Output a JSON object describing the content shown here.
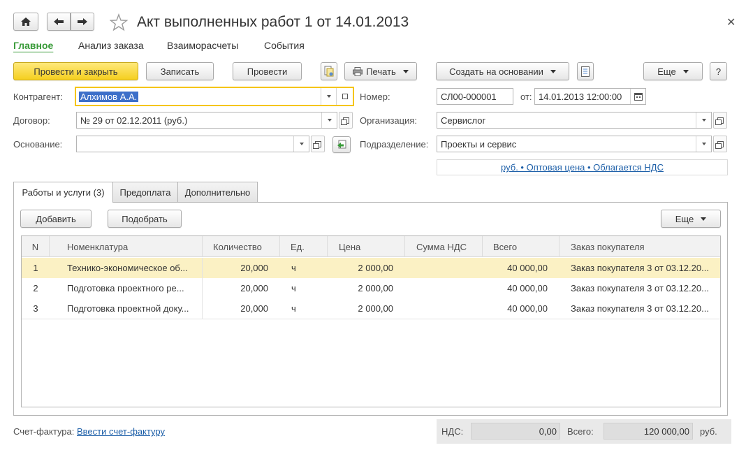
{
  "window": {
    "title": "Акт выполненных работ 1 от 14.01.2013"
  },
  "nav_tabs": [
    {
      "label": "Главное"
    },
    {
      "label": "Анализ заказа"
    },
    {
      "label": "Взаиморасчеты"
    },
    {
      "label": "События"
    }
  ],
  "toolbar": {
    "post_close": "Провести и закрыть",
    "save": "Записать",
    "post": "Провести",
    "print": "Печать",
    "create_based": "Создать на основании",
    "more": "Еще",
    "help": "?"
  },
  "form": {
    "counterparty_label": "Контрагент:",
    "counterparty_value": "Алхимов А.А.",
    "contract_label": "Договор:",
    "contract_value": "№ 29 от 02.12.2011 (руб.)",
    "basis_label": "Основание:",
    "basis_value": "",
    "number_label": "Номер:",
    "number_value": "СЛ00-000001",
    "date_label": "от:",
    "date_value": "14.01.2013 12:00:00",
    "org_label": "Организация:",
    "org_value": "Сервислог",
    "division_label": "Подразделение:",
    "division_value": "Проекты и сервис",
    "price_info": "руб. • Оптовая цена • Облагается НДС"
  },
  "section_tabs": [
    {
      "label": "Работы и услуги (3)"
    },
    {
      "label": "Предоплата"
    },
    {
      "label": "Дополнительно"
    }
  ],
  "table_toolbar": {
    "add": "Добавить",
    "pick": "Подобрать",
    "more": "Еще"
  },
  "table": {
    "columns": [
      "N",
      "Номенклатура",
      "Количество",
      "Ед.",
      "Цена",
      "Сумма НДС",
      "Всего",
      "Заказ покупателя"
    ],
    "rows": [
      {
        "n": "1",
        "item": "Технико-экономическое об...",
        "qty": "20,000",
        "unit": "ч",
        "price": "2 000,00",
        "vat": "",
        "total": "40 000,00",
        "order": "Заказ покупателя 3 от 03.12.20..."
      },
      {
        "n": "2",
        "item": "Подготовка проектного ре...",
        "qty": "20,000",
        "unit": "ч",
        "price": "2 000,00",
        "vat": "",
        "total": "40 000,00",
        "order": "Заказ покупателя 3 от 03.12.20..."
      },
      {
        "n": "3",
        "item": "Подготовка проектной доку...",
        "qty": "20,000",
        "unit": "ч",
        "price": "2 000,00",
        "vat": "",
        "total": "40 000,00",
        "order": "Заказ покупателя 3 от 03.12.20..."
      }
    ]
  },
  "footer": {
    "invoice_label": "Счет-фактура:",
    "invoice_link": "Ввести счет-фактуру",
    "vat_label": "НДС:",
    "vat_value": "0,00",
    "total_label": "Всего:",
    "total_value": "120 000,00",
    "currency": "руб."
  },
  "colors": {
    "accent_green": "#3a9b3a",
    "primary_button": "#f5cf1f",
    "selected_row": "#fbf1c4",
    "link": "#1d5fa8"
  },
  "icons": [
    "home-icon",
    "back-arrow-icon",
    "forward-arrow-icon",
    "star-icon",
    "close-icon",
    "document-structure-icon",
    "printer-icon",
    "report-icon",
    "dropdown-icon",
    "open-icon",
    "calendar-icon",
    "fill-icon"
  ]
}
